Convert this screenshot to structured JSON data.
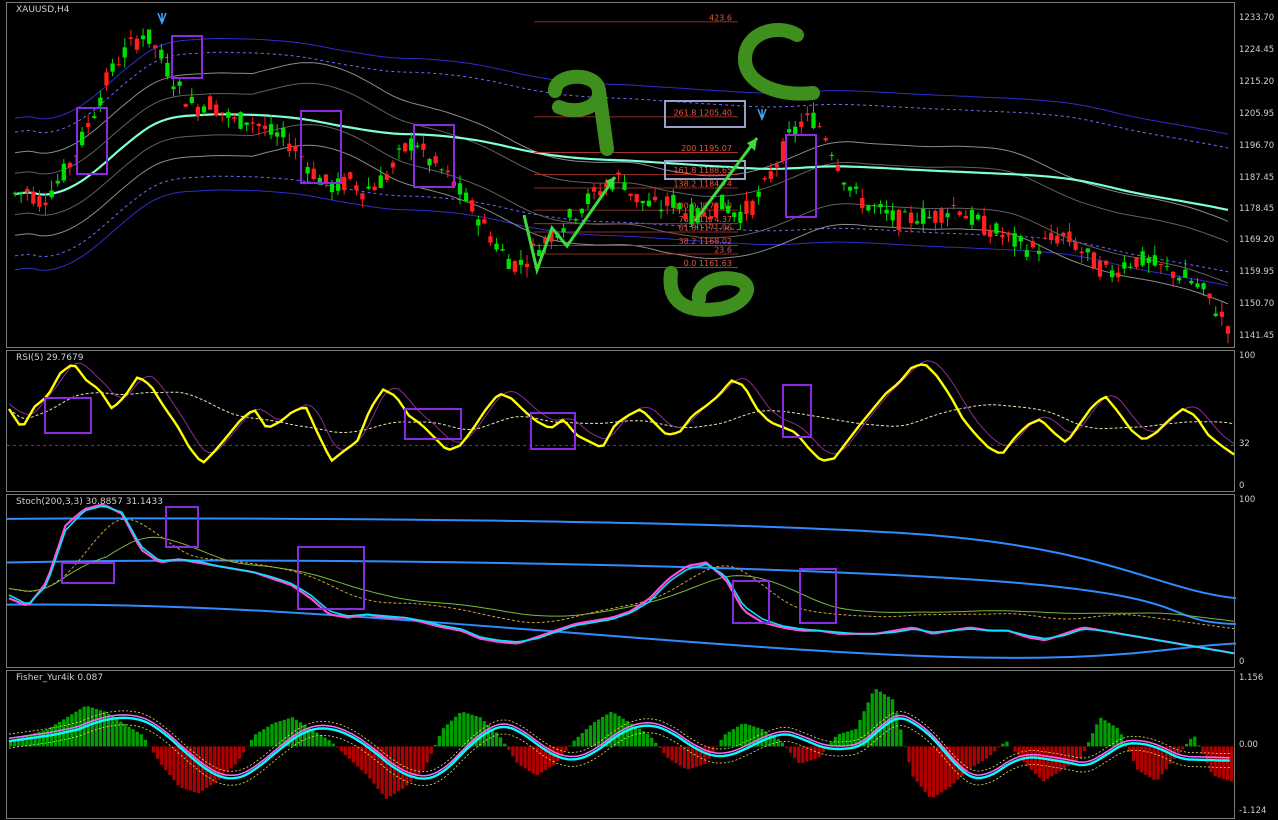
{
  "chart_data": [
    {
      "type": "candlestick",
      "title": "XAUUSD,H4",
      "ylim": [
        1141.45,
        1235.0
      ],
      "y_ticks": [
        "1233.70",
        "1224.45",
        "1215.20",
        "1205.95",
        "1196.70",
        "1187.45",
        "1178.45",
        "1169.20",
        "1159.95",
        "1150.70",
        "1141.45"
      ],
      "fib_levels": [
        {
          "label": "423.6",
          "value": 1233.0
        },
        {
          "label": "261.8 1205.40",
          "value": 1205.4
        },
        {
          "label": "200 1195.07",
          "value": 1195.07
        },
        {
          "label": "161.8 1188.65",
          "value": 1188.65
        },
        {
          "label": "138.2 1184.74",
          "value": 1184.74
        },
        {
          "label": "100.0 1178.30",
          "value": 1178.3
        },
        {
          "label": "76.4 1174.37",
          "value": 1174.37
        },
        {
          "label": "61.8 1171.96",
          "value": 1171.96
        },
        {
          "label": "38.2 1168.02",
          "value": 1168.02
        },
        {
          "label": "23.6",
          "value": 1165.56
        },
        {
          "label": "0.0 1161.63",
          "value": 1161.63
        }
      ],
      "price_path": [
        1183,
        1184,
        1181,
        1185,
        1190,
        1197,
        1206,
        1215,
        1222,
        1226,
        1230,
        1225,
        1218,
        1212,
        1208,
        1210,
        1207,
        1204,
        1205,
        1203,
        1200,
        1199,
        1195,
        1190,
        1186,
        1185,
        1187,
        1184,
        1186,
        1189,
        1195,
        1199,
        1193,
        1190,
        1186,
        1181,
        1176,
        1170,
        1165,
        1162,
        1166,
        1169,
        1173,
        1176,
        1180,
        1183,
        1186,
        1188,
        1182,
        1180,
        1179,
        1181,
        1178,
        1176,
        1179,
        1180,
        1177,
        1179,
        1184,
        1192,
        1199,
        1204,
        1205,
        1199,
        1190,
        1183,
        1180,
        1178,
        1176,
        1175,
        1177,
        1176,
        1178,
        1180,
        1176,
        1174,
        1172,
        1170,
        1168,
        1167,
        1169,
        1171,
        1169,
        1165,
        1162,
        1160,
        1163,
        1164,
        1163,
        1161,
        1160,
        1158,
        1155,
        1150,
        1145
      ]
    },
    {
      "type": "line",
      "title": "RSI(5) 29.7679",
      "ylim": [
        0,
        100
      ],
      "y_ticks": [
        "100",
        "32",
        "0"
      ],
      "level": 32,
      "series": [
        {
          "name": "RSI(5)",
          "color": "#ffff00",
          "values": [
            60,
            45,
            62,
            70,
            88,
            95,
            82,
            75,
            60,
            70,
            85,
            78,
            62,
            48,
            30,
            18,
            28,
            40,
            52,
            60,
            45,
            50,
            58,
            62,
            40,
            20,
            28,
            35,
            60,
            75,
            70,
            55,
            48,
            38,
            28,
            32,
            45,
            60,
            72,
            68,
            58,
            50,
            45,
            52,
            40,
            35,
            30,
            48,
            55,
            60,
            50,
            40,
            42,
            55,
            62,
            70,
            82,
            78,
            60,
            50,
            46,
            42,
            30,
            20,
            22,
            35,
            48,
            60,
            72,
            80,
            92,
            95,
            85,
            70,
            52,
            40,
            30,
            25,
            38,
            48,
            52,
            42,
            34,
            48,
            62,
            70,
            58,
            44,
            36,
            42,
            52,
            60,
            55,
            40,
            32,
            25
          ]
        }
      ]
    },
    {
      "type": "line",
      "title": "Stoch(200,3,3) 30.8857 31.1433",
      "ylim": [
        0,
        100
      ],
      "y_ticks": [
        "100",
        "0"
      ],
      "series": [
        {
          "name": "Main",
          "color": "#ff4fd8",
          "values": [
            40,
            35,
            50,
            85,
            95,
            98,
            92,
            70,
            62,
            64,
            62,
            60,
            58,
            56,
            52,
            48,
            40,
            30,
            28,
            30,
            28,
            28,
            25,
            22,
            20,
            15,
            13,
            12,
            16,
            20,
            24,
            26,
            28,
            32,
            40,
            52,
            60,
            62,
            52,
            32,
            25,
            22,
            20,
            20,
            18,
            18,
            18,
            20,
            22,
            18,
            20,
            22,
            20,
            20,
            16,
            14,
            18,
            22,
            20,
            18,
            16,
            14,
            12,
            10,
            8,
            6
          ]
        },
        {
          "name": "Signal",
          "color": "#00e6ff",
          "values": [
            42,
            36,
            48,
            82,
            94,
            97,
            93,
            72,
            63,
            64,
            63,
            60,
            58,
            56,
            53,
            49,
            42,
            32,
            29,
            30,
            29,
            28,
            26,
            23,
            21,
            16,
            14,
            13,
            15,
            19,
            23,
            25,
            27,
            31,
            38,
            50,
            58,
            61,
            54,
            35,
            27,
            23,
            21,
            20,
            19,
            18,
            18,
            19,
            21,
            19,
            20,
            21,
            20,
            20,
            17,
            15,
            17,
            21,
            20,
            18,
            16,
            14,
            12,
            10,
            8,
            6
          ]
        }
      ]
    },
    {
      "type": "bar",
      "title": "Fisher_Yur4ik 0.087",
      "ylim": [
        -1.124,
        1.156
      ],
      "y_ticks": [
        "1.156",
        "0.00",
        "-1.124"
      ],
      "colors": {
        "positive": "#00a000",
        "negative": "#b00000",
        "line": "#39ff39"
      },
      "values": [
        0.1,
        0.2,
        0.3,
        0.5,
        0.7,
        0.6,
        0.4,
        0.2,
        -0.3,
        -0.7,
        -0.8,
        -0.6,
        -0.3,
        0.2,
        0.4,
        0.5,
        0.3,
        0.1,
        -0.2,
        -0.5,
        -0.9,
        -0.7,
        -0.4,
        0.3,
        0.6,
        0.5,
        0.2,
        -0.3,
        -0.5,
        -0.3,
        0.1,
        0.4,
        0.6,
        0.4,
        0.2,
        -0.2,
        -0.4,
        -0.3,
        0.2,
        0.4,
        0.3,
        0.1,
        -0.3,
        -0.2,
        0.2,
        0.3,
        1.0,
        0.8,
        -0.5,
        -0.9,
        -0.7,
        -0.4,
        -0.2,
        0.1,
        -0.3,
        -0.6,
        -0.4,
        -0.2,
        0.5,
        0.3,
        -0.4,
        -0.6,
        -0.2,
        0.2,
        -0.5,
        -0.6
      ]
    }
  ]
}
